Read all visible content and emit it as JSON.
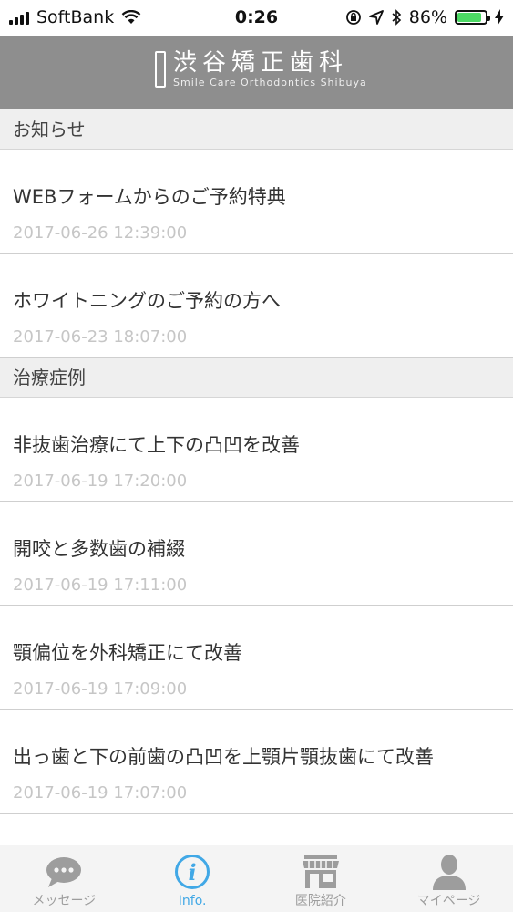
{
  "status_bar": {
    "carrier": "SoftBank",
    "time": "0:26",
    "battery_percent": "86%",
    "battery_level": 0.86
  },
  "header": {
    "title": "渋谷矯正歯科",
    "subtitle": "Smile Care Orthodontics Shibuya"
  },
  "sections": [
    {
      "title": "お知らせ",
      "items": [
        {
          "title": "WEBフォームからのご予約特典",
          "date": "2017-06-26 12:39:00"
        },
        {
          "title": "ホワイトニングのご予約の方へ",
          "date": "2017-06-23 18:07:00"
        }
      ]
    },
    {
      "title": "治療症例",
      "items": [
        {
          "title": "非抜歯治療にて上下の凸凹を改善",
          "date": "2017-06-19 17:20:00"
        },
        {
          "title": "開咬と多数歯の補綴",
          "date": "2017-06-19 17:11:00"
        },
        {
          "title": "顎偏位を外科矯正にて改善",
          "date": "2017-06-19 17:09:00"
        },
        {
          "title": "出っ歯と下の前歯の凸凹を上顎片顎抜歯にて改善",
          "date": "2017-06-19 17:07:00"
        }
      ]
    }
  ],
  "tabs": [
    {
      "label": "メッセージ",
      "icon": "chat-bubble-icon",
      "active": false
    },
    {
      "label": "Info.",
      "icon": "info-icon",
      "active": true
    },
    {
      "label": "医院紹介",
      "icon": "store-icon",
      "active": false
    },
    {
      "label": "マイページ",
      "icon": "person-icon",
      "active": false
    }
  ],
  "colors": {
    "header_bg": "#8e8e8e",
    "accent": "#41a8e6",
    "battery": "#4cd964"
  }
}
